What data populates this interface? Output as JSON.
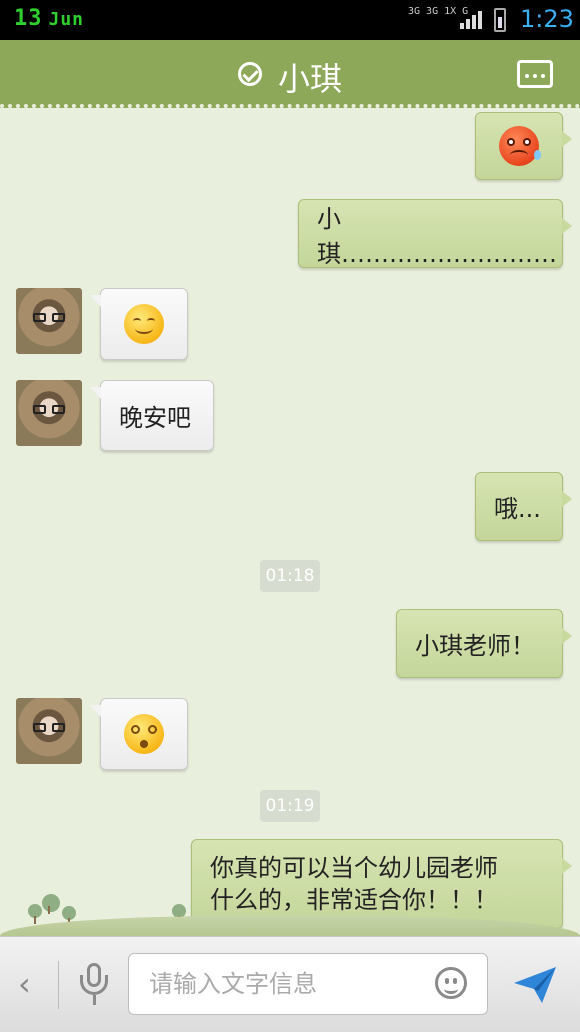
{
  "status_bar": {
    "date_day": "13",
    "date_month": "Jun",
    "network_top": "3G 3G 1X G",
    "time": "1:23"
  },
  "header": {
    "title": "小琪",
    "more_icon": "more-dots-icon",
    "verified_icon": "check-circle-icon"
  },
  "messages": [
    {
      "side": "out",
      "type": "emoji",
      "emoji": "sad-face"
    },
    {
      "side": "out",
      "type": "text",
      "text": "小琪………………………"
    },
    {
      "side": "in",
      "type": "emoji",
      "emoji": "smile-face"
    },
    {
      "side": "in",
      "type": "text",
      "text": "晚安吧"
    },
    {
      "side": "out",
      "type": "text",
      "text": "哦..."
    },
    {
      "side": "time",
      "text": "01:18"
    },
    {
      "side": "out",
      "type": "text",
      "text": "小琪老师！"
    },
    {
      "side": "in",
      "type": "emoji",
      "emoji": "dizzy-face"
    },
    {
      "side": "time",
      "text": "01:19"
    },
    {
      "side": "out",
      "type": "text",
      "text": "你真的可以当个幼儿园老师什么的，非常适合你！！！",
      "lines": [
        "你真的可以当个幼儿园老师",
        "什么的，非常适合你！！！"
      ]
    }
  ],
  "input_bar": {
    "placeholder": "请输入文字信息",
    "back_icon": "chevron-left-icon",
    "mic_icon": "microphone-icon",
    "emoji_icon": "smiley-icon",
    "send_icon": "send-icon"
  },
  "colors": {
    "header_bg": "#8ea85a",
    "chat_bg": "#e9efdd",
    "outgoing_bubble": "#c9da9f",
    "incoming_bubble": "#f3f3f3",
    "time_accent": "#3ab0f0"
  }
}
